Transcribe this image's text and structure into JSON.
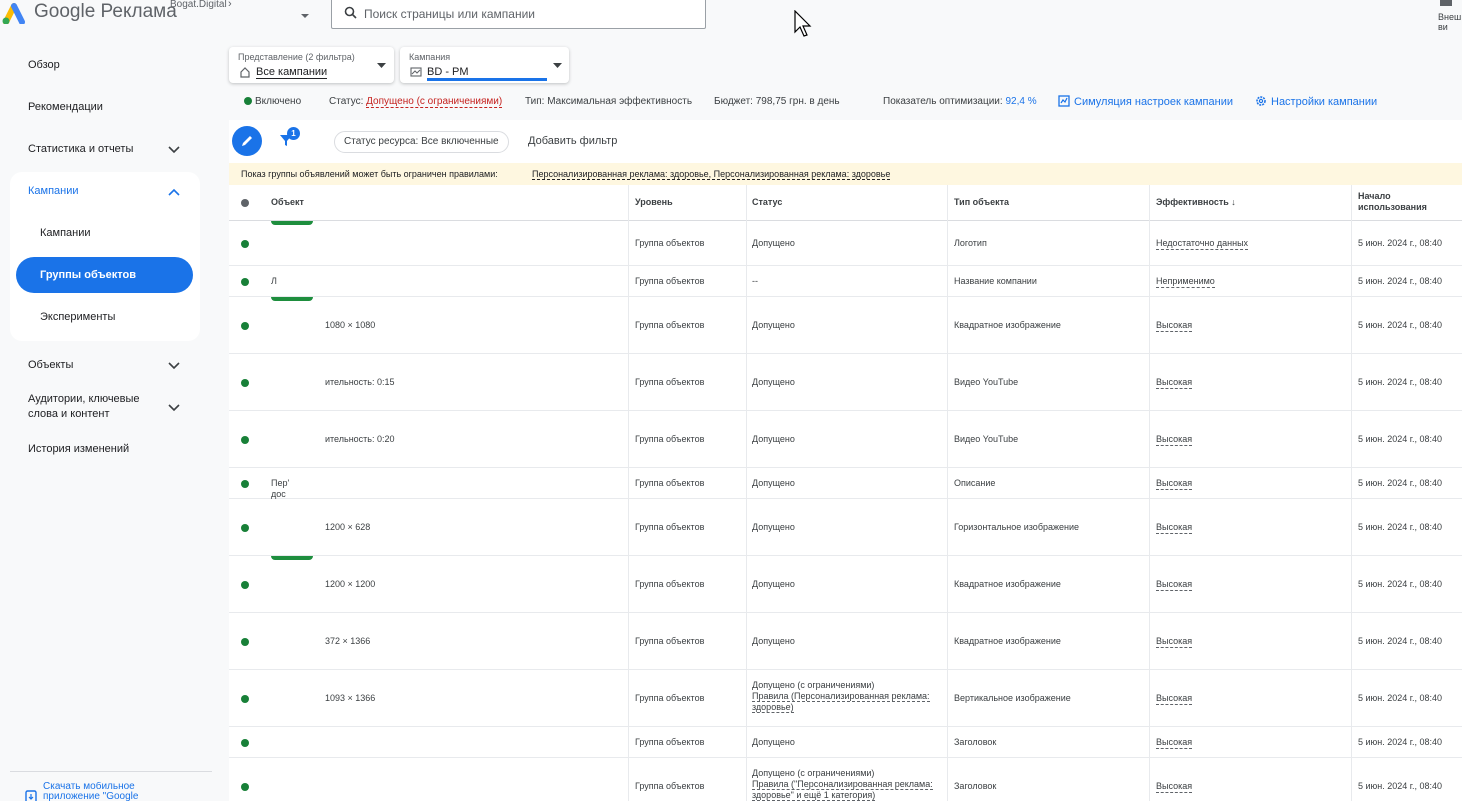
{
  "app": {
    "brand": "Google Реклама",
    "account": "Bogat.Digital",
    "search_placeholder": "Поиск страницы или кампании",
    "external_label": "Внеш ви"
  },
  "sidebar": {
    "items": [
      {
        "label": "Обзор"
      },
      {
        "label": "Рекомендации"
      },
      {
        "label": "Статистика и отчеты"
      },
      {
        "label": "Кампании"
      },
      {
        "label": "Объекты"
      },
      {
        "label": "Аудитории, ключевые слова и контент"
      },
      {
        "label": "История изменений"
      }
    ],
    "sub_items": [
      {
        "label": "Кампании"
      },
      {
        "label": "Группы объектов"
      },
      {
        "label": "Эксперименты"
      }
    ],
    "mobile_link": "Скачать мобильное приложение \"Google"
  },
  "filters": {
    "view_label": "Представление (2 фильтра)",
    "view_value": "Все кампании",
    "campaign_label": "Кампания",
    "campaign_value": "BD - PM"
  },
  "status": {
    "enabled": "Включено",
    "status_label": "Статус:",
    "status_value": "Допущено (с ограничениями)",
    "type_label": "Тип:",
    "type_value": "Максимальная эффективность",
    "budget_label": "Бюджет:",
    "budget_value": "798,75 грн. в день",
    "opt_label": "Показатель оптимизации:",
    "opt_value": "92,4 %",
    "simulate": "Симуляция настроек кампании",
    "settings": "Настройки кампании"
  },
  "toolbar": {
    "filter_count": "1",
    "chip": "Статус ресурса: Все включенные",
    "add_filter": "Добавить фильтр"
  },
  "banner": {
    "text": "Показ группы объявлений может быть ограничен правилами:",
    "link": "Персонализированная реклама: здоровье, Персонализированная реклама: здоровье"
  },
  "table": {
    "headers": [
      "Объект",
      "Уровень",
      "Статус",
      "Тип объекта",
      "Эффективность",
      "Начало использования"
    ],
    "rows": [
      {
        "object": "",
        "level": "Группа объектов",
        "status": "Допущено",
        "status2": "",
        "type": "Логотип",
        "eff": "Недостаточно данных",
        "start": "5 июн. 2024 г., 08:40"
      },
      {
        "object": "Л",
        "level": "Группа объектов",
        "status": "--",
        "status2": "",
        "type": "Название компании",
        "eff": "Неприменимо",
        "start": "5 июн. 2024 г., 08:40"
      },
      {
        "object": "1080 × 1080",
        "level": "Группа объектов",
        "status": "Допущено",
        "status2": "",
        "type": "Квадратное изображение",
        "eff": "Высокая",
        "start": "5 июн. 2024 г., 08:40"
      },
      {
        "object": "ительность: 0:15",
        "level": "Группа объектов",
        "status": "Допущено",
        "status2": "",
        "type": "Видео YouTube",
        "eff": "Высокая",
        "start": "5 июн. 2024 г., 08:40"
      },
      {
        "object": "ительность: 0:20",
        "level": "Группа объектов",
        "status": "Допущено",
        "status2": "",
        "type": "Видео YouTube",
        "eff": "Высокая",
        "start": "5 июн. 2024 г., 08:40"
      },
      {
        "object": "Пер' дос",
        "level": "Группа объектов",
        "status": "Допущено",
        "status2": "",
        "type": "Описание",
        "eff": "Высокая",
        "start": "5 июн. 2024 г., 08:40"
      },
      {
        "object": "1200 × 628",
        "level": "Группа объектов",
        "status": "Допущено",
        "status2": "",
        "type": "Горизонтальное изображение",
        "eff": "Высокая",
        "start": "5 июн. 2024 г., 08:40"
      },
      {
        "object": "1200 × 1200",
        "level": "Группа объектов",
        "status": "Допущено",
        "status2": "",
        "type": "Квадратное изображение",
        "eff": "Высокая",
        "start": "5 июн. 2024 г., 08:40"
      },
      {
        "object": "372 × 1366",
        "level": "Группа объектов",
        "status": "Допущено",
        "status2": "",
        "type": "Квадратное изображение",
        "eff": "Высокая",
        "start": "5 июн. 2024 г., 08:40"
      },
      {
        "object": "1093 × 1366",
        "level": "Группа объектов",
        "status": "Допущено (с ограничениями)",
        "status2": "Правила (Персонализированная реклама: здоровье)",
        "type": "Вертикальное изображение",
        "eff": "Высокая",
        "start": "5 июн. 2024 г., 08:40"
      },
      {
        "object": "",
        "level": "Группа объектов",
        "status": "Допущено",
        "status2": "",
        "type": "Заголовок",
        "eff": "Высокая",
        "start": "5 июн. 2024 г., 08:40"
      },
      {
        "object": "",
        "level": "Группа объектов",
        "status": "Допущено (с ограничениями)",
        "status2": "Правила (\"Персонализированная реклама: здоровье\" и ещё 1 категория)",
        "type": "Заголовок",
        "eff": "Высокая",
        "start": "5 июн. 2024 г., 08:40"
      }
    ]
  }
}
